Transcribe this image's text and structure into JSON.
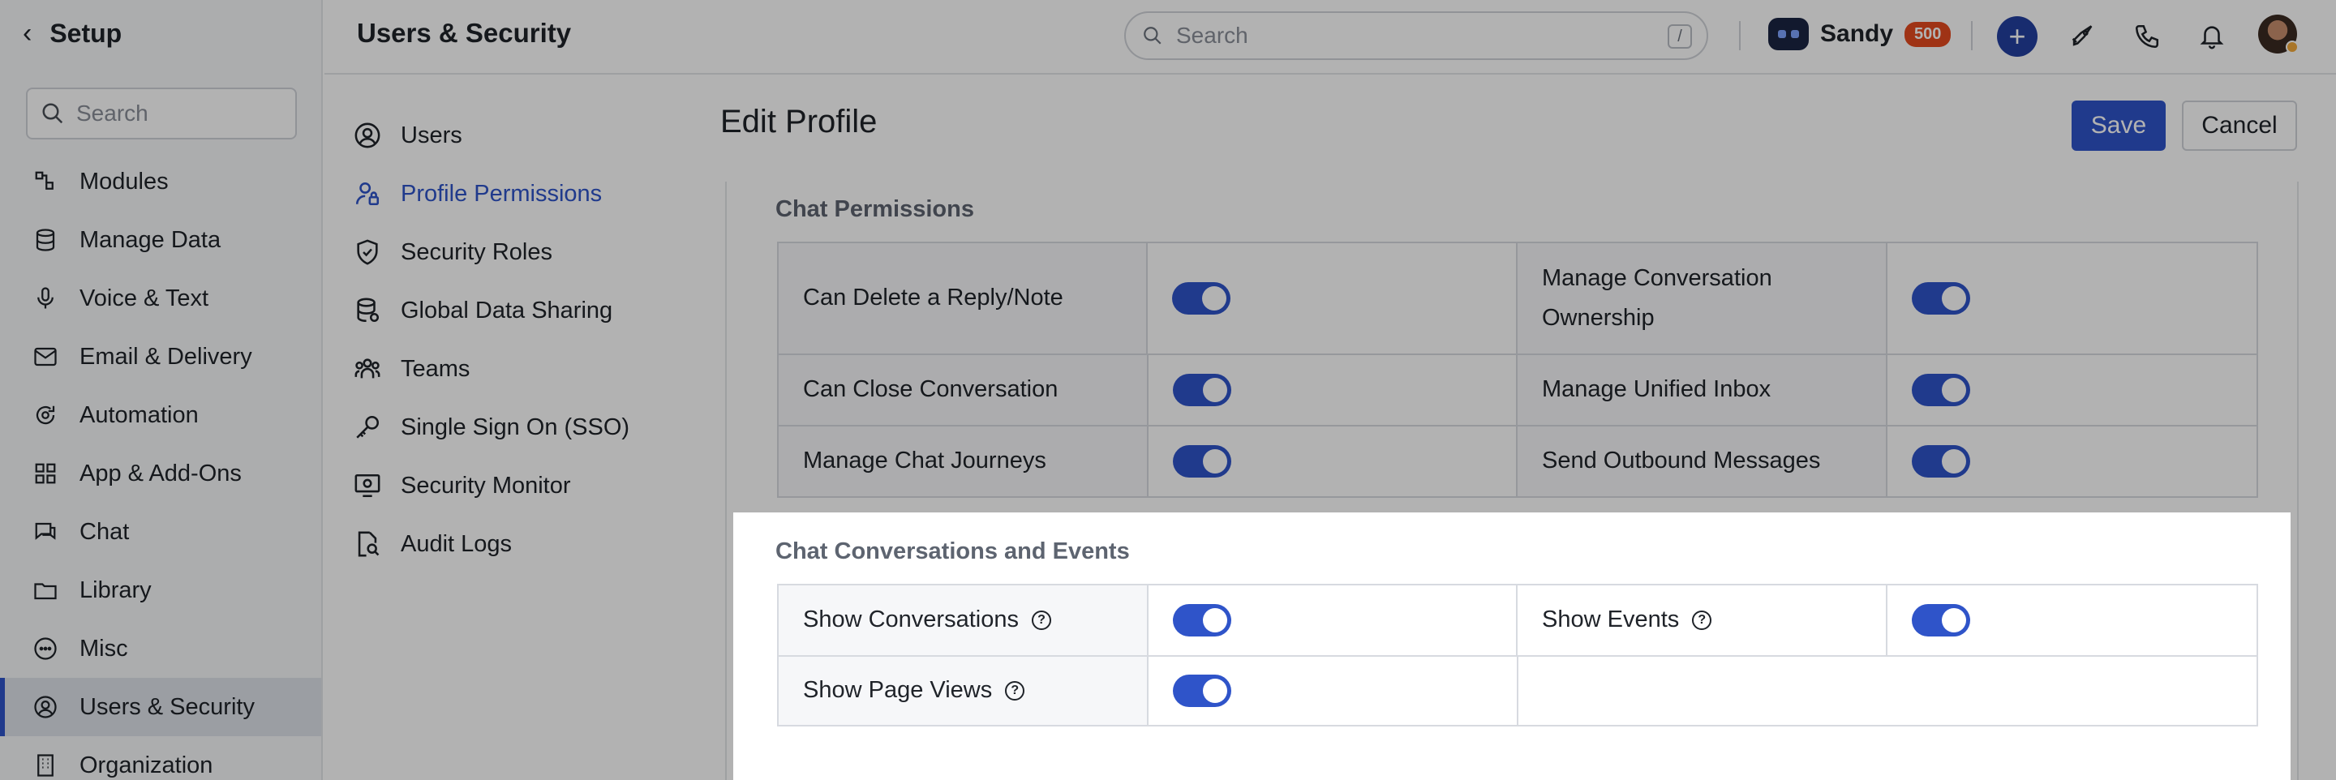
{
  "sidebar": {
    "title": "Setup",
    "search_placeholder": "Search",
    "items": [
      {
        "label": "Modules",
        "icon": "modules-icon"
      },
      {
        "label": "Manage Data",
        "icon": "database-icon"
      },
      {
        "label": "Voice & Text",
        "icon": "microphone-icon"
      },
      {
        "label": "Email & Delivery",
        "icon": "mail-icon"
      },
      {
        "label": "Automation",
        "icon": "automation-icon"
      },
      {
        "label": "App & Add-Ons",
        "icon": "apps-icon"
      },
      {
        "label": "Chat",
        "icon": "chat-icon"
      },
      {
        "label": "Library",
        "icon": "folder-icon"
      },
      {
        "label": "Misc",
        "icon": "more-icon"
      },
      {
        "label": "Users & Security",
        "icon": "user-circle-icon",
        "active": true
      },
      {
        "label": "Organization",
        "icon": "building-icon"
      }
    ]
  },
  "header": {
    "title": "Users & Security",
    "search_placeholder": "Search",
    "search_shortcut": "/",
    "user_name": "Sandy",
    "badge_count": "500"
  },
  "subnav": {
    "items": [
      {
        "label": "Users",
        "icon": "user-circle-icon"
      },
      {
        "label": "Profile Permissions",
        "icon": "user-lock-icon",
        "active": true
      },
      {
        "label": "Security Roles",
        "icon": "shield-icon"
      },
      {
        "label": "Global Data Sharing",
        "icon": "database-share-icon"
      },
      {
        "label": "Teams",
        "icon": "team-icon"
      },
      {
        "label": "Single Sign On (SSO)",
        "icon": "key-icon"
      },
      {
        "label": "Security Monitor",
        "icon": "monitor-icon"
      },
      {
        "label": "Audit Logs",
        "icon": "document-search-icon"
      }
    ]
  },
  "main": {
    "title": "Edit Profile",
    "save_label": "Save",
    "cancel_label": "Cancel",
    "sections": [
      {
        "title": "Chat Permissions",
        "rows": [
          [
            {
              "label": "Can Delete a Reply/Note",
              "on": true
            },
            {
              "label": "Manage Conversation Ownership",
              "on": true
            }
          ],
          [
            {
              "label": "Can Close Conversation",
              "on": true
            },
            {
              "label": "Manage Unified Inbox",
              "on": true
            }
          ],
          [
            {
              "label": "Manage Chat Journeys",
              "on": true
            },
            {
              "label": "Send Outbound Messages",
              "on": true
            }
          ]
        ]
      },
      {
        "title": "Chat Conversations and Events",
        "rows": [
          [
            {
              "label": "Show Conversations",
              "on": true,
              "help": true
            },
            {
              "label": "Show Events",
              "on": true,
              "help": true
            }
          ],
          [
            {
              "label": "Show Page Views",
              "on": true,
              "help": true
            }
          ]
        ]
      }
    ]
  },
  "colors": {
    "accent": "#2f54c9",
    "badge": "#e44a1f",
    "dim_overlay": "rgba(0,0,0,0.30)"
  }
}
